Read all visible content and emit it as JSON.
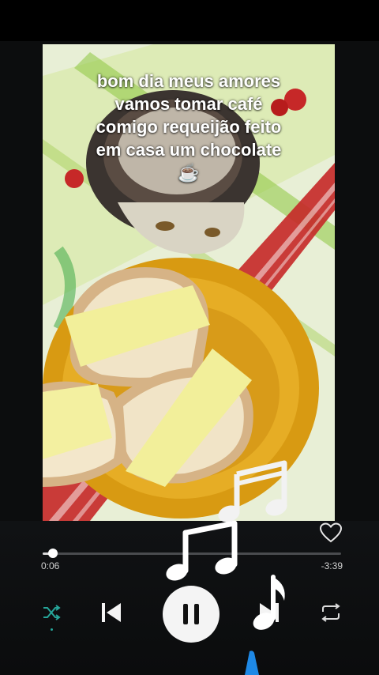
{
  "caption": {
    "lines": [
      "bom dia meus amores",
      "vamos tomar café",
      "comigo requeijão feito",
      "em casa um chocolate",
      "☕"
    ]
  },
  "player": {
    "elapsed": "0:06",
    "remaining": "-3:39",
    "progress_fraction": 0.035,
    "state": "playing",
    "liked": false
  },
  "icons": {
    "like": "heart-outline-icon",
    "shuffle": "shuffle-icon",
    "previous": "skip-previous-icon",
    "play_pause": "pause-icon",
    "next": "skip-next-icon",
    "repeat": "repeat-icon",
    "sticker": "music-notes-icon"
  },
  "colors": {
    "accent": "#26a69a",
    "background": "#0c0d0e",
    "sticker_blue": "#1e88e5"
  }
}
